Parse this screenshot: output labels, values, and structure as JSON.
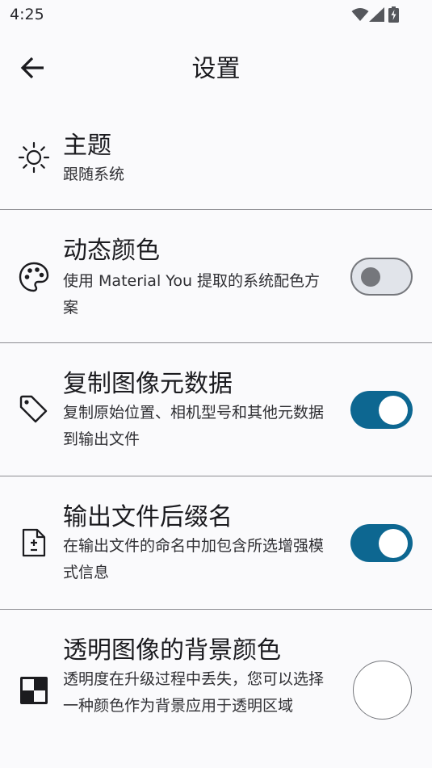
{
  "status_bar": {
    "time": "4:25",
    "icons": [
      "wifi-icon",
      "signal-icon",
      "battery-charging-icon"
    ]
  },
  "app_bar": {
    "title": "设置",
    "back_icon": "arrow-back-icon"
  },
  "settings": [
    {
      "title": "主题",
      "subtitle": "跟随系统",
      "icon": "sun-icon",
      "control": "none"
    },
    {
      "title": "动态颜色",
      "subtitle": "使用 Material You 提取的系统配色方案",
      "icon": "palette-icon",
      "control": "switch",
      "checked": false
    },
    {
      "title": "复制图像元数据",
      "subtitle": "复制原始位置、相机型号和其他元数据到输出文件",
      "icon": "tag-icon",
      "control": "switch",
      "checked": true
    },
    {
      "title": "输出文件后缀名",
      "subtitle": "在输出文件的命名中加包含所选增强模式信息",
      "icon": "file-plus-minus-icon",
      "control": "switch",
      "checked": true
    },
    {
      "title": "透明图像的背景颜色",
      "subtitle": "透明度在升级过程中丢失，您可以选择一种颜色作为背景应用于透明区域",
      "icon": "checkerboard-icon",
      "control": "color",
      "color": "#ffffff"
    }
  ],
  "colors": {
    "accent": "#0d6791",
    "background": "#fafafc",
    "divider": "#8c8c92"
  }
}
